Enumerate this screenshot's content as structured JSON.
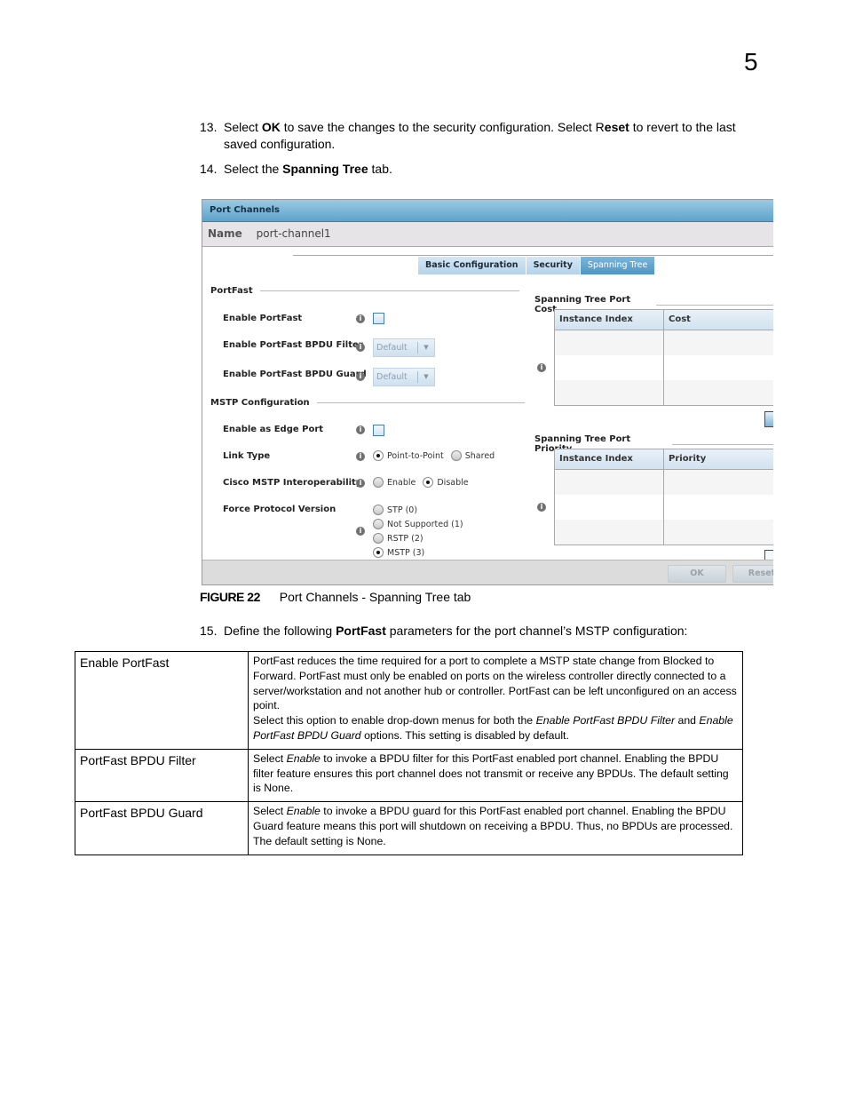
{
  "page": {
    "chapter_number": "5"
  },
  "steps": [
    {
      "number": "13.",
      "parts": [
        {
          "t": "Select ",
          "b": false
        },
        {
          "t": "OK",
          "b": true
        },
        {
          "t": " to save the changes to the security configuration. Select R",
          "b": false
        },
        {
          "t": "eset",
          "b": true
        },
        {
          "t": " to revert to the last",
          "b": false
        }
      ],
      "continuation": "saved configuration."
    },
    {
      "number": "14.",
      "parts": [
        {
          "t": "Select the ",
          "b": false
        },
        {
          "t": "Spanning Tree",
          "b": true
        },
        {
          "t": " tab.",
          "b": false
        }
      ]
    },
    {
      "number": "15.",
      "parts": [
        {
          "t": "Define the following ",
          "b": false
        },
        {
          "t": "PortFast",
          "b": true
        },
        {
          "t": " parameters for the port channel’s MSTP configuration:",
          "b": false
        }
      ]
    }
  ],
  "dialog": {
    "title": "Port Channels",
    "name_label": "Name",
    "name_value": "port-channel1",
    "tabs": [
      {
        "label": "Basic Configuration",
        "active": false
      },
      {
        "label": "Security",
        "active": false
      },
      {
        "label": "Spanning Tree",
        "active": true
      }
    ],
    "portfast": {
      "section_title": "PortFast",
      "enable_portfast": {
        "label": "Enable PortFast",
        "checked": false
      },
      "bpdu_filter": {
        "label": "Enable PortFast BPDU Filter",
        "value": "Default"
      },
      "bpdu_guard": {
        "label": "Enable PortFast BPDU Guard",
        "value": "Default"
      }
    },
    "mstp": {
      "section_title": "MSTP Configuration",
      "edge_port": {
        "label": "Enable as Edge Port",
        "checked": false
      },
      "link_type": {
        "label": "Link Type",
        "options": [
          "Point-to-Point",
          "Shared"
        ],
        "selected": "Point-to-Point"
      },
      "cisco_interop": {
        "label": "Cisco MSTP Interoperability",
        "options": [
          "Enable",
          "Disable"
        ],
        "selected": "Disable"
      },
      "force_protocol": {
        "label": "Force Protocol Version",
        "options": [
          "STP (0)",
          "Not Supported (1)",
          "RSTP (2)",
          "MSTP (3)"
        ],
        "selected": "MSTP (3)"
      }
    },
    "port_cost": {
      "section_title": "Spanning Tree Port Cost",
      "columns": [
        "Instance Index",
        "Cost"
      ],
      "rows": []
    },
    "port_priority": {
      "section_title": "Spanning Tree Port Priority",
      "columns": [
        "Instance Index",
        "Priority"
      ],
      "rows": []
    },
    "buttons": {
      "ok": "OK",
      "reset": "Reset"
    },
    "info_glyph": "i"
  },
  "figure": {
    "label": "FIGURE 22",
    "caption": "Port Channels - Spanning Tree tab"
  },
  "desc_table": [
    {
      "term": "Enable PortFast",
      "paragraphs": [
        [
          {
            "t": "PortFast reduces the time required for a port to complete a MSTP state change from Blocked to Forward. PortFast must only be enabled on ports on the wireless controller directly connected to a server/workstation and not another hub or controller. PortFast can be left unconfigured on an access point.",
            "i": false
          }
        ],
        [
          {
            "t": "Select this option to enable drop-down menus for both the ",
            "i": false
          },
          {
            "t": "Enable PortFast BPDU Filter",
            "i": true
          },
          {
            "t": " and ",
            "i": false
          },
          {
            "t": "Enable PortFast BPDU Guard",
            "i": true
          },
          {
            "t": " options. This setting is disabled by default.",
            "i": false
          }
        ]
      ]
    },
    {
      "term": "PortFast BPDU Filter",
      "paragraphs": [
        [
          {
            "t": "Select ",
            "i": false
          },
          {
            "t": "Enable",
            "i": true
          },
          {
            "t": " to invoke a BPDU filter for this PortFast enabled port channel. Enabling the BPDU filter feature ensures this port channel does not transmit or receive any BPDUs. The default setting is None.",
            "i": false
          }
        ]
      ]
    },
    {
      "term": "PortFast BPDU Guard",
      "paragraphs": [
        [
          {
            "t": "Select ",
            "i": false
          },
          {
            "t": "Enable",
            "i": true
          },
          {
            "t": " to invoke a BPDU guard for this PortFast enabled port channel. Enabling the BPDU Guard feature means this port will shutdown on receiving a BPDU. Thus, no BPDUs are processed. The default setting is None.",
            "i": false
          }
        ]
      ]
    }
  ]
}
